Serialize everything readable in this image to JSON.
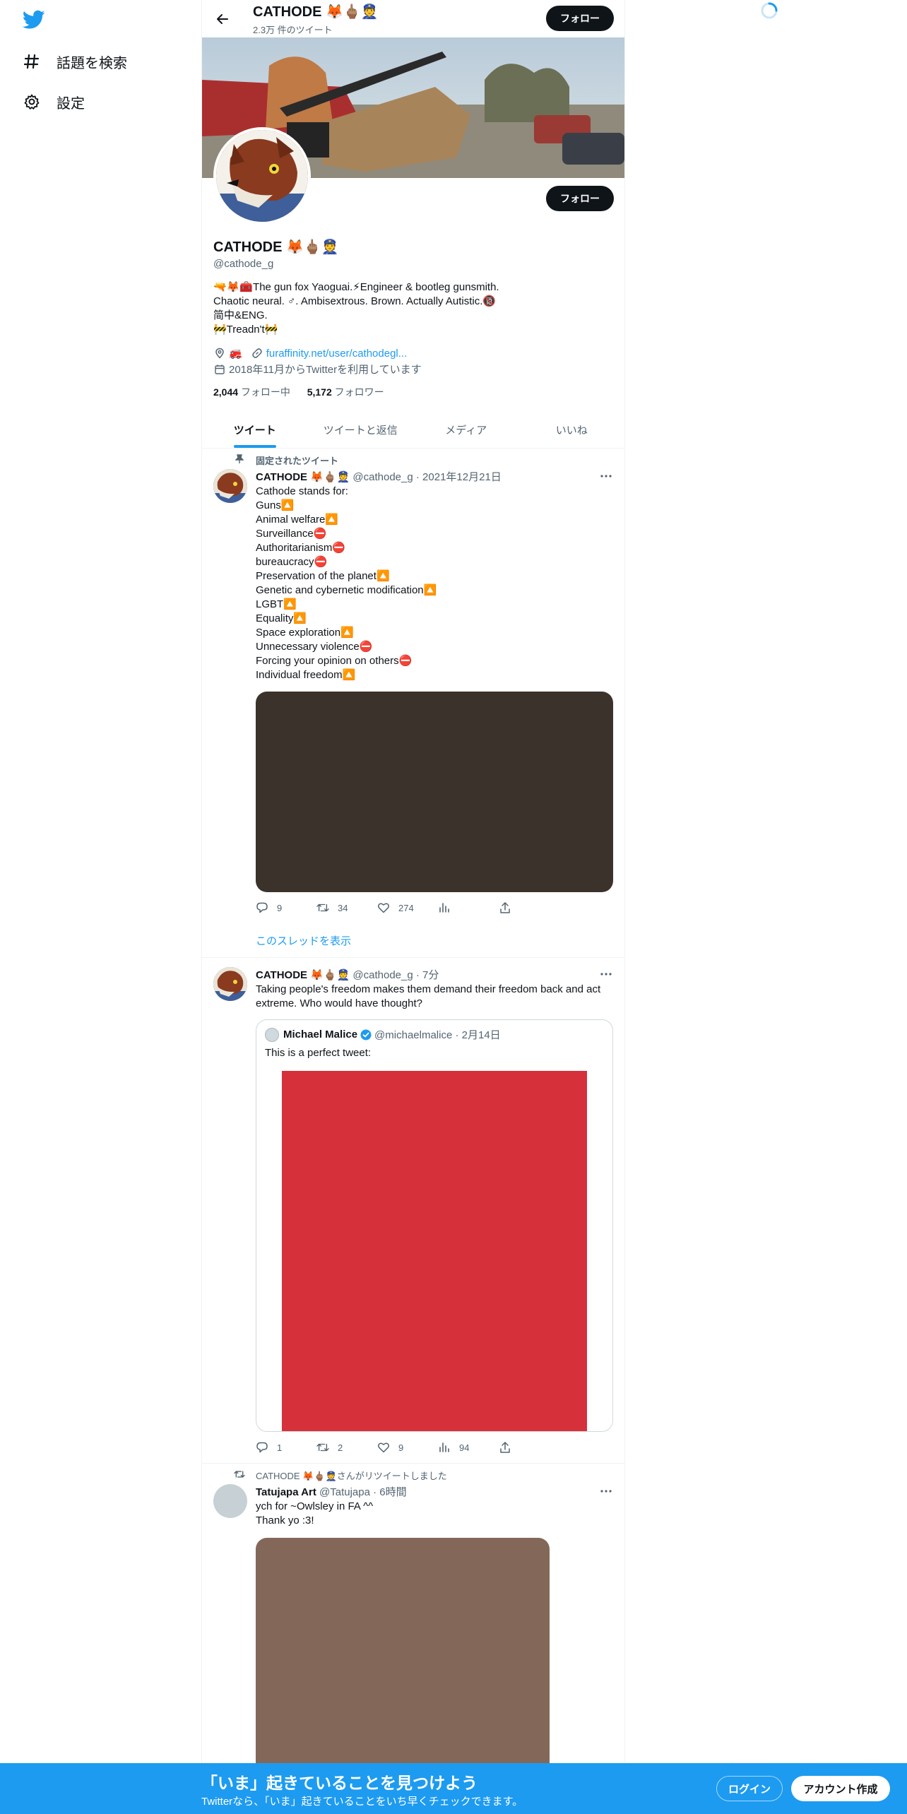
{
  "colors": {
    "accent": "#1d9bf0",
    "text": "#0f1419",
    "muted": "#536471"
  },
  "sidebar": {
    "logo_icon": "twitter-bird-icon",
    "items": [
      {
        "label": "話題を検索",
        "icon": "hashtag-icon"
      },
      {
        "label": "設定",
        "icon": "gear-icon"
      }
    ]
  },
  "header": {
    "name": "CATHODE 🦊🖕🏽👮",
    "tweet_count": "2.3万 件のツイート",
    "follow_label": "フォロー"
  },
  "profile": {
    "name": "CATHODE 🦊🖕🏽👮",
    "handle": "@cathode_g",
    "follow_label": "フォロー",
    "bio": [
      "🔫🦊🧰The gun fox Yaoguai.⚡Engineer & bootleg gunsmith.",
      "Chaotic neural. ♂. Ambisextrous. Brown. Actually Autistic.🔞",
      "简中&ENG.",
      "🚧Treadn't🚧"
    ],
    "location": "🚒",
    "link": "furaffinity.net/user/cathodegl...",
    "joined": "2018年11月からTwitterを利用しています",
    "following_count": "2,044",
    "following_label": "フォロー中",
    "followers_count": "5,172",
    "followers_label": "フォロワー"
  },
  "tabs": [
    {
      "label": "ツイート",
      "active": true
    },
    {
      "label": "ツイートと返信",
      "active": false
    },
    {
      "label": "メディア",
      "active": false
    },
    {
      "label": "いいね",
      "active": false
    }
  ],
  "tweets": [
    {
      "pinned_label": "固定されたツイート",
      "name": "CATHODE 🦊🖕🏽👮",
      "meta": "@cathode_g · 2021年12月21日",
      "lines": [
        "Cathode stands for:",
        "Guns🔼",
        "Animal welfare🔼",
        "Surveillance⛔",
        "Authoritarianism⛔",
        "bureaucracy⛔",
        "Preservation of the planet🔼",
        "Genetic and cybernetic modification🔼",
        "LGBT🔼",
        "Equality🔼",
        "Space exploration🔼",
        "Unnecessary violence⛔",
        "Forcing your opinion on others⛔",
        "Individual freedom🔼"
      ],
      "media_color": "#3b322c",
      "replies": "9",
      "retweets": "34",
      "likes": "274",
      "views": "",
      "show_thread": "このスレッドを表示"
    },
    {
      "name": "CATHODE 🦊🖕🏽👮",
      "meta": "@cathode_g · 7分",
      "lines": [
        "Taking people's freedom makes them demand their freedom back and act",
        "extreme. Who would have thought?"
      ],
      "quote": {
        "name": "Michael Malice",
        "meta": "@michaelmalice · 2月14日",
        "text": "This is a perfect tweet:",
        "image_color": "#d6303a"
      },
      "replies": "1",
      "retweets": "2",
      "likes": "9",
      "views": "94"
    },
    {
      "retweeted_by": "CATHODE 🦊🖕🏽👮さんがリツイートしました",
      "name": "Tatujapa Art",
      "meta": "@Tatujapa · 6時間",
      "lines": [
        "ych for ~Owlsley in FA ^^",
        "Thank yo :3!"
      ],
      "media_color": "#83685a"
    }
  ],
  "bottom_bar": {
    "title": "「いま」起きていることを見つけよう",
    "subtitle": "Twitterなら、「いま」起きていることをいち早くチェックできます。",
    "login_label": "ログイン",
    "signup_label": "アカウント作成"
  }
}
